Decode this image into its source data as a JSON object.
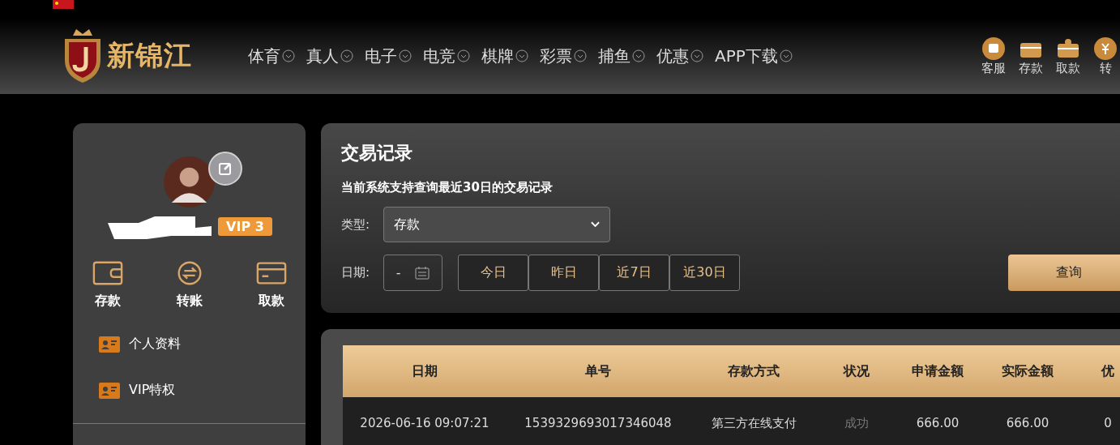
{
  "header": {
    "brand": "新锦江",
    "nav": [
      {
        "label": "体育"
      },
      {
        "label": "真人"
      },
      {
        "label": "电子"
      },
      {
        "label": "电竞"
      },
      {
        "label": "棋牌"
      },
      {
        "label": "彩票"
      },
      {
        "label": "捕鱼"
      },
      {
        "label": "优惠"
      },
      {
        "label": "APP下载"
      }
    ],
    "quick_links": [
      {
        "kind": "chat",
        "label": "客服"
      },
      {
        "kind": "wallet",
        "label": "存款"
      },
      {
        "kind": "withdraw",
        "label": "取款"
      },
      {
        "kind": "yuan",
        "label": "转"
      }
    ]
  },
  "profile": {
    "vip": "VIP 3",
    "actions": [
      {
        "kind": "wallet",
        "label": "存款"
      },
      {
        "kind": "transfer",
        "label": "转账"
      },
      {
        "kind": "card",
        "label": "取款"
      }
    ],
    "menu": [
      {
        "label": "个人资料"
      },
      {
        "label": "VIP特权"
      }
    ]
  },
  "filter": {
    "title": "交易记录",
    "note": "当前系统支持查询最近30日的交易记录",
    "type_label": "类型:",
    "type_value": "存款",
    "date_label": "日期:",
    "date_value": "-",
    "ranges": [
      {
        "label": "今日"
      },
      {
        "label": "昨日"
      },
      {
        "label": "近7日"
      },
      {
        "label": "近30日"
      }
    ],
    "query_button": "查询"
  },
  "table": {
    "columns": [
      {
        "label": "日期",
        "kind": "text"
      },
      {
        "label": "单号",
        "kind": "text"
      },
      {
        "label": "存款方式",
        "kind": "text"
      },
      {
        "label": "状况",
        "kind": "status"
      },
      {
        "label": "申请金额",
        "kind": "text"
      },
      {
        "label": "实际金额",
        "kind": "text"
      },
      {
        "label": "优",
        "kind": "text"
      }
    ],
    "rows": [
      {
        "cells": [
          "2026-06-16 09:07:21",
          "1539329693017346048",
          "第三方在线支付",
          "成功",
          "666.00",
          "666.00",
          "0"
        ]
      }
    ]
  }
}
